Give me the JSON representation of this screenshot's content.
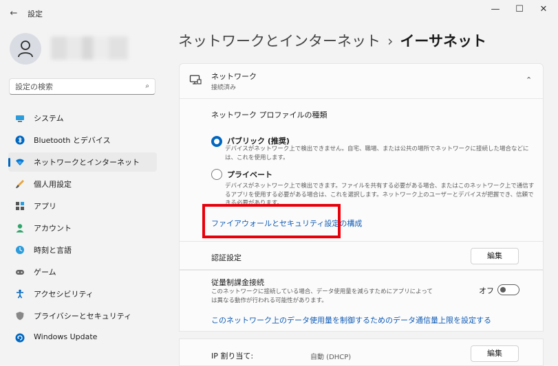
{
  "titlebar": {
    "back_glyph": "←",
    "app_title": "設定",
    "min_glyph": "—",
    "max_glyph": "☐",
    "close_glyph": "✕"
  },
  "sidebar": {
    "search_placeholder": "設定の検索",
    "search_glyph": "⌕",
    "items": [
      {
        "label": "システム",
        "icon": "monitor-icon"
      },
      {
        "label": "Bluetooth とデバイス",
        "icon": "bluetooth-icon"
      },
      {
        "label": "ネットワークとインターネット",
        "icon": "wifi-icon",
        "active": true
      },
      {
        "label": "個人用設定",
        "icon": "brush-icon"
      },
      {
        "label": "アプリ",
        "icon": "apps-icon"
      },
      {
        "label": "アカウント",
        "icon": "person-icon"
      },
      {
        "label": "時刻と言語",
        "icon": "globe-clock-icon"
      },
      {
        "label": "ゲーム",
        "icon": "gamepad-icon"
      },
      {
        "label": "アクセシビリティ",
        "icon": "accessibility-icon"
      },
      {
        "label": "プライバシーとセキュリティ",
        "icon": "shield-icon"
      },
      {
        "label": "Windows Update",
        "icon": "update-icon"
      }
    ]
  },
  "breadcrumb": {
    "parent": "ネットワークとインターネット",
    "separator": "›",
    "current": "イーサネット"
  },
  "network_card": {
    "title": "ネットワーク",
    "status": "接続済み",
    "chevron": "⌃",
    "profile_heading": "ネットワーク プロファイルの種類",
    "public_label": "パブリック (推奨)",
    "public_desc": "デバイスがネットワーク上で検出できません。自宅、職場、または公共の場所でネットワークに接続した場合などには、これを使用します。",
    "private_label": "プライベート",
    "private_desc": "デバイスがネットワーク上で検出できます。ファイルを共有する必要がある場合、またはこのネットワーク上で通信するアプリを使用する必要がある場合は、これを選択します。ネットワーク上のユーザーとデバイスが把握でき、信頼できる必要があります。",
    "firewall_link": "ファイアウォールとセキュリティ設定の構成",
    "selected_profile": "public"
  },
  "auth": {
    "label": "認証設定",
    "edit_label": "編集"
  },
  "metered": {
    "label": "従量制課金接続",
    "desc": "このネットワークに接続している場合、データ使用量を減らすためにアプリによっては異なる動作が行われる可能性があります。",
    "toggle_label": "オフ",
    "toggle_on": false,
    "data_limit_link": "このネットワーク上のデータ使用量を制御するためのデータ通信量上限を設定する"
  },
  "ip": {
    "label": "IP 割り当て:",
    "value": "自動 (DHCP)",
    "edit_label": "編集"
  },
  "colors": {
    "accent": "#0067c0",
    "highlight": "#e8000b",
    "link": "#0f5bb5"
  }
}
